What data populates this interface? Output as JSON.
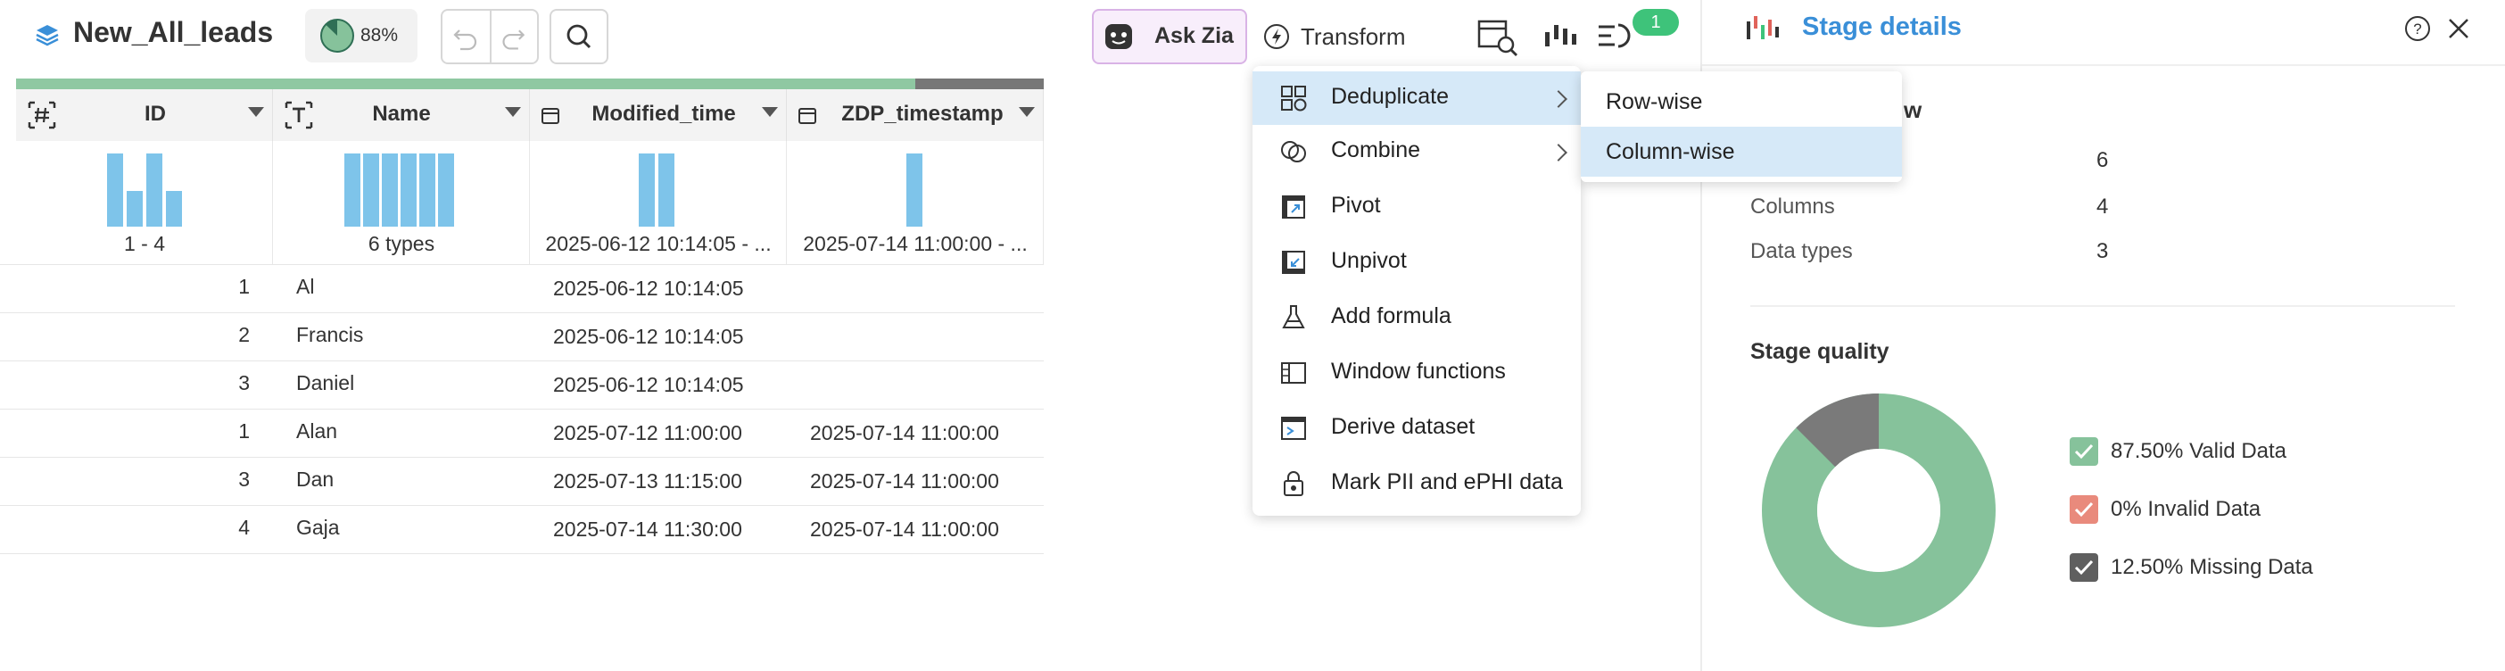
{
  "toolbar": {
    "title": "New_All_leads",
    "quality_pct": "88%",
    "ask_zia": "Ask Zia",
    "transform": "Transform",
    "badge_count": "1"
  },
  "columns": [
    {
      "name": "ID",
      "type_icon": "hash-icon",
      "summary": "1 - 4"
    },
    {
      "name": "Name",
      "type_icon": "text-type-icon",
      "summary": "6 types"
    },
    {
      "name": "Modified_time",
      "type_icon": "calendar-icon",
      "summary": "2025-06-12 10:14:05 - ..."
    },
    {
      "name": "ZDP_timestamp",
      "type_icon": "calendar-icon",
      "summary": "2025-07-14 11:00:00 - ..."
    }
  ],
  "rows": [
    {
      "id": "1",
      "name": "Al",
      "modified": "2025-06-12 10:14:05",
      "zdp": ""
    },
    {
      "id": "2",
      "name": "Francis",
      "modified": "2025-06-12 10:14:05",
      "zdp": ""
    },
    {
      "id": "3",
      "name": "Daniel",
      "modified": "2025-06-12 10:14:05",
      "zdp": ""
    },
    {
      "id": "1",
      "name": "Alan",
      "modified": "2025-07-12 11:00:00",
      "zdp": "2025-07-14 11:00:00"
    },
    {
      "id": "3",
      "name": "Dan",
      "modified": "2025-07-13 11:15:00",
      "zdp": "2025-07-14 11:00:00"
    },
    {
      "id": "4",
      "name": "Gaja",
      "modified": "2025-07-14 11:30:00",
      "zdp": "2025-07-14 11:00:00"
    }
  ],
  "menu": {
    "items": [
      {
        "label": "Deduplicate",
        "icon": "deduplicate-icon",
        "has_submenu": true
      },
      {
        "label": "Combine",
        "icon": "combine-icon",
        "has_submenu": true
      },
      {
        "label": "Pivot",
        "icon": "pivot-icon",
        "has_submenu": false
      },
      {
        "label": "Unpivot",
        "icon": "unpivot-icon",
        "has_submenu": false
      },
      {
        "label": "Add formula",
        "icon": "formula-flask-icon",
        "has_submenu": false
      },
      {
        "label": "Window functions",
        "icon": "window-functions-icon",
        "has_submenu": false
      },
      {
        "label": "Derive dataset",
        "icon": "derive-dataset-icon",
        "has_submenu": false
      },
      {
        "label": "Mark PII and ePHI data",
        "icon": "pii-lock-icon",
        "has_submenu": false
      }
    ],
    "submenu": [
      "Row-wise",
      "Column-wise"
    ]
  },
  "panel": {
    "title": "Stage details",
    "overview_heading_partial": "w",
    "overview": [
      {
        "label": "",
        "value": "6"
      },
      {
        "label": "Columns",
        "value": "4"
      },
      {
        "label": "Data types",
        "value": "3"
      }
    ],
    "quality_title": "Stage quality",
    "quality": [
      {
        "label": "87.50% Valid Data",
        "value": 87.5,
        "color": "#86c29b"
      },
      {
        "label": "0% Invalid Data",
        "value": 0,
        "color": "#e98a7c"
      },
      {
        "label": "12.50% Missing Data",
        "value": 12.5,
        "color": "#7a7a7a"
      }
    ]
  },
  "colors": {
    "accent": "#3a8fd8",
    "valid": "#86c29b",
    "missing": "#7a7a7a",
    "histogram": "#7ec4ea",
    "highlight": "#d6e9f8"
  }
}
